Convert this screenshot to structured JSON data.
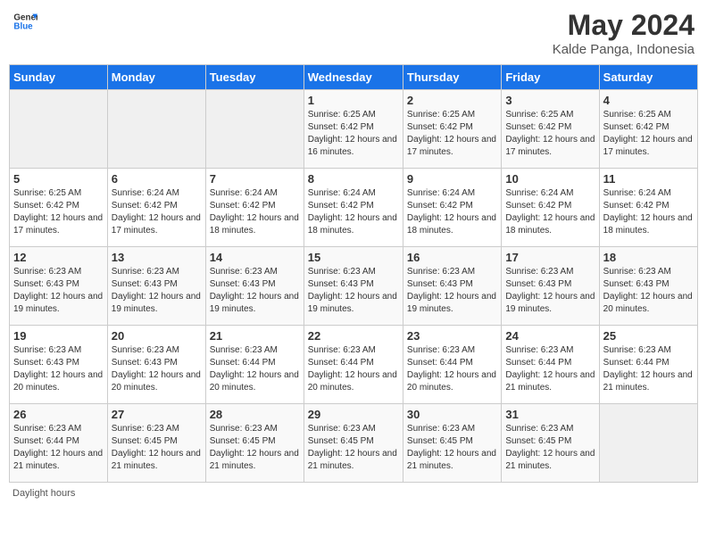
{
  "logo": {
    "line1": "General",
    "line2": "Blue",
    "icon_color": "#1a73e8"
  },
  "title": "May 2024",
  "subtitle": "Kalde Panga, Indonesia",
  "days_of_week": [
    "Sunday",
    "Monday",
    "Tuesday",
    "Wednesday",
    "Thursday",
    "Friday",
    "Saturday"
  ],
  "footer": "Daylight hours",
  "weeks": [
    [
      {
        "day": "",
        "sunrise": "",
        "sunset": "",
        "daylight": "",
        "empty": true
      },
      {
        "day": "",
        "sunrise": "",
        "sunset": "",
        "daylight": "",
        "empty": true
      },
      {
        "day": "",
        "sunrise": "",
        "sunset": "",
        "daylight": "",
        "empty": true
      },
      {
        "day": "1",
        "sunrise": "Sunrise: 6:25 AM",
        "sunset": "Sunset: 6:42 PM",
        "daylight": "Daylight: 12 hours and 16 minutes."
      },
      {
        "day": "2",
        "sunrise": "Sunrise: 6:25 AM",
        "sunset": "Sunset: 6:42 PM",
        "daylight": "Daylight: 12 hours and 17 minutes."
      },
      {
        "day": "3",
        "sunrise": "Sunrise: 6:25 AM",
        "sunset": "Sunset: 6:42 PM",
        "daylight": "Daylight: 12 hours and 17 minutes."
      },
      {
        "day": "4",
        "sunrise": "Sunrise: 6:25 AM",
        "sunset": "Sunset: 6:42 PM",
        "daylight": "Daylight: 12 hours and 17 minutes."
      }
    ],
    [
      {
        "day": "5",
        "sunrise": "Sunrise: 6:25 AM",
        "sunset": "Sunset: 6:42 PM",
        "daylight": "Daylight: 12 hours and 17 minutes."
      },
      {
        "day": "6",
        "sunrise": "Sunrise: 6:24 AM",
        "sunset": "Sunset: 6:42 PM",
        "daylight": "Daylight: 12 hours and 17 minutes."
      },
      {
        "day": "7",
        "sunrise": "Sunrise: 6:24 AM",
        "sunset": "Sunset: 6:42 PM",
        "daylight": "Daylight: 12 hours and 18 minutes."
      },
      {
        "day": "8",
        "sunrise": "Sunrise: 6:24 AM",
        "sunset": "Sunset: 6:42 PM",
        "daylight": "Daylight: 12 hours and 18 minutes."
      },
      {
        "day": "9",
        "sunrise": "Sunrise: 6:24 AM",
        "sunset": "Sunset: 6:42 PM",
        "daylight": "Daylight: 12 hours and 18 minutes."
      },
      {
        "day": "10",
        "sunrise": "Sunrise: 6:24 AM",
        "sunset": "Sunset: 6:42 PM",
        "daylight": "Daylight: 12 hours and 18 minutes."
      },
      {
        "day": "11",
        "sunrise": "Sunrise: 6:24 AM",
        "sunset": "Sunset: 6:42 PM",
        "daylight": "Daylight: 12 hours and 18 minutes."
      }
    ],
    [
      {
        "day": "12",
        "sunrise": "Sunrise: 6:23 AM",
        "sunset": "Sunset: 6:43 PM",
        "daylight": "Daylight: 12 hours and 19 minutes."
      },
      {
        "day": "13",
        "sunrise": "Sunrise: 6:23 AM",
        "sunset": "Sunset: 6:43 PM",
        "daylight": "Daylight: 12 hours and 19 minutes."
      },
      {
        "day": "14",
        "sunrise": "Sunrise: 6:23 AM",
        "sunset": "Sunset: 6:43 PM",
        "daylight": "Daylight: 12 hours and 19 minutes."
      },
      {
        "day": "15",
        "sunrise": "Sunrise: 6:23 AM",
        "sunset": "Sunset: 6:43 PM",
        "daylight": "Daylight: 12 hours and 19 minutes."
      },
      {
        "day": "16",
        "sunrise": "Sunrise: 6:23 AM",
        "sunset": "Sunset: 6:43 PM",
        "daylight": "Daylight: 12 hours and 19 minutes."
      },
      {
        "day": "17",
        "sunrise": "Sunrise: 6:23 AM",
        "sunset": "Sunset: 6:43 PM",
        "daylight": "Daylight: 12 hours and 19 minutes."
      },
      {
        "day": "18",
        "sunrise": "Sunrise: 6:23 AM",
        "sunset": "Sunset: 6:43 PM",
        "daylight": "Daylight: 12 hours and 20 minutes."
      }
    ],
    [
      {
        "day": "19",
        "sunrise": "Sunrise: 6:23 AM",
        "sunset": "Sunset: 6:43 PM",
        "daylight": "Daylight: 12 hours and 20 minutes."
      },
      {
        "day": "20",
        "sunrise": "Sunrise: 6:23 AM",
        "sunset": "Sunset: 6:43 PM",
        "daylight": "Daylight: 12 hours and 20 minutes."
      },
      {
        "day": "21",
        "sunrise": "Sunrise: 6:23 AM",
        "sunset": "Sunset: 6:44 PM",
        "daylight": "Daylight: 12 hours and 20 minutes."
      },
      {
        "day": "22",
        "sunrise": "Sunrise: 6:23 AM",
        "sunset": "Sunset: 6:44 PM",
        "daylight": "Daylight: 12 hours and 20 minutes."
      },
      {
        "day": "23",
        "sunrise": "Sunrise: 6:23 AM",
        "sunset": "Sunset: 6:44 PM",
        "daylight": "Daylight: 12 hours and 20 minutes."
      },
      {
        "day": "24",
        "sunrise": "Sunrise: 6:23 AM",
        "sunset": "Sunset: 6:44 PM",
        "daylight": "Daylight: 12 hours and 21 minutes."
      },
      {
        "day": "25",
        "sunrise": "Sunrise: 6:23 AM",
        "sunset": "Sunset: 6:44 PM",
        "daylight": "Daylight: 12 hours and 21 minutes."
      }
    ],
    [
      {
        "day": "26",
        "sunrise": "Sunrise: 6:23 AM",
        "sunset": "Sunset: 6:44 PM",
        "daylight": "Daylight: 12 hours and 21 minutes."
      },
      {
        "day": "27",
        "sunrise": "Sunrise: 6:23 AM",
        "sunset": "Sunset: 6:45 PM",
        "daylight": "Daylight: 12 hours and 21 minutes."
      },
      {
        "day": "28",
        "sunrise": "Sunrise: 6:23 AM",
        "sunset": "Sunset: 6:45 PM",
        "daylight": "Daylight: 12 hours and 21 minutes."
      },
      {
        "day": "29",
        "sunrise": "Sunrise: 6:23 AM",
        "sunset": "Sunset: 6:45 PM",
        "daylight": "Daylight: 12 hours and 21 minutes."
      },
      {
        "day": "30",
        "sunrise": "Sunrise: 6:23 AM",
        "sunset": "Sunset: 6:45 PM",
        "daylight": "Daylight: 12 hours and 21 minutes."
      },
      {
        "day": "31",
        "sunrise": "Sunrise: 6:23 AM",
        "sunset": "Sunset: 6:45 PM",
        "daylight": "Daylight: 12 hours and 21 minutes."
      },
      {
        "day": "",
        "sunrise": "",
        "sunset": "",
        "daylight": "",
        "empty": true
      }
    ]
  ]
}
